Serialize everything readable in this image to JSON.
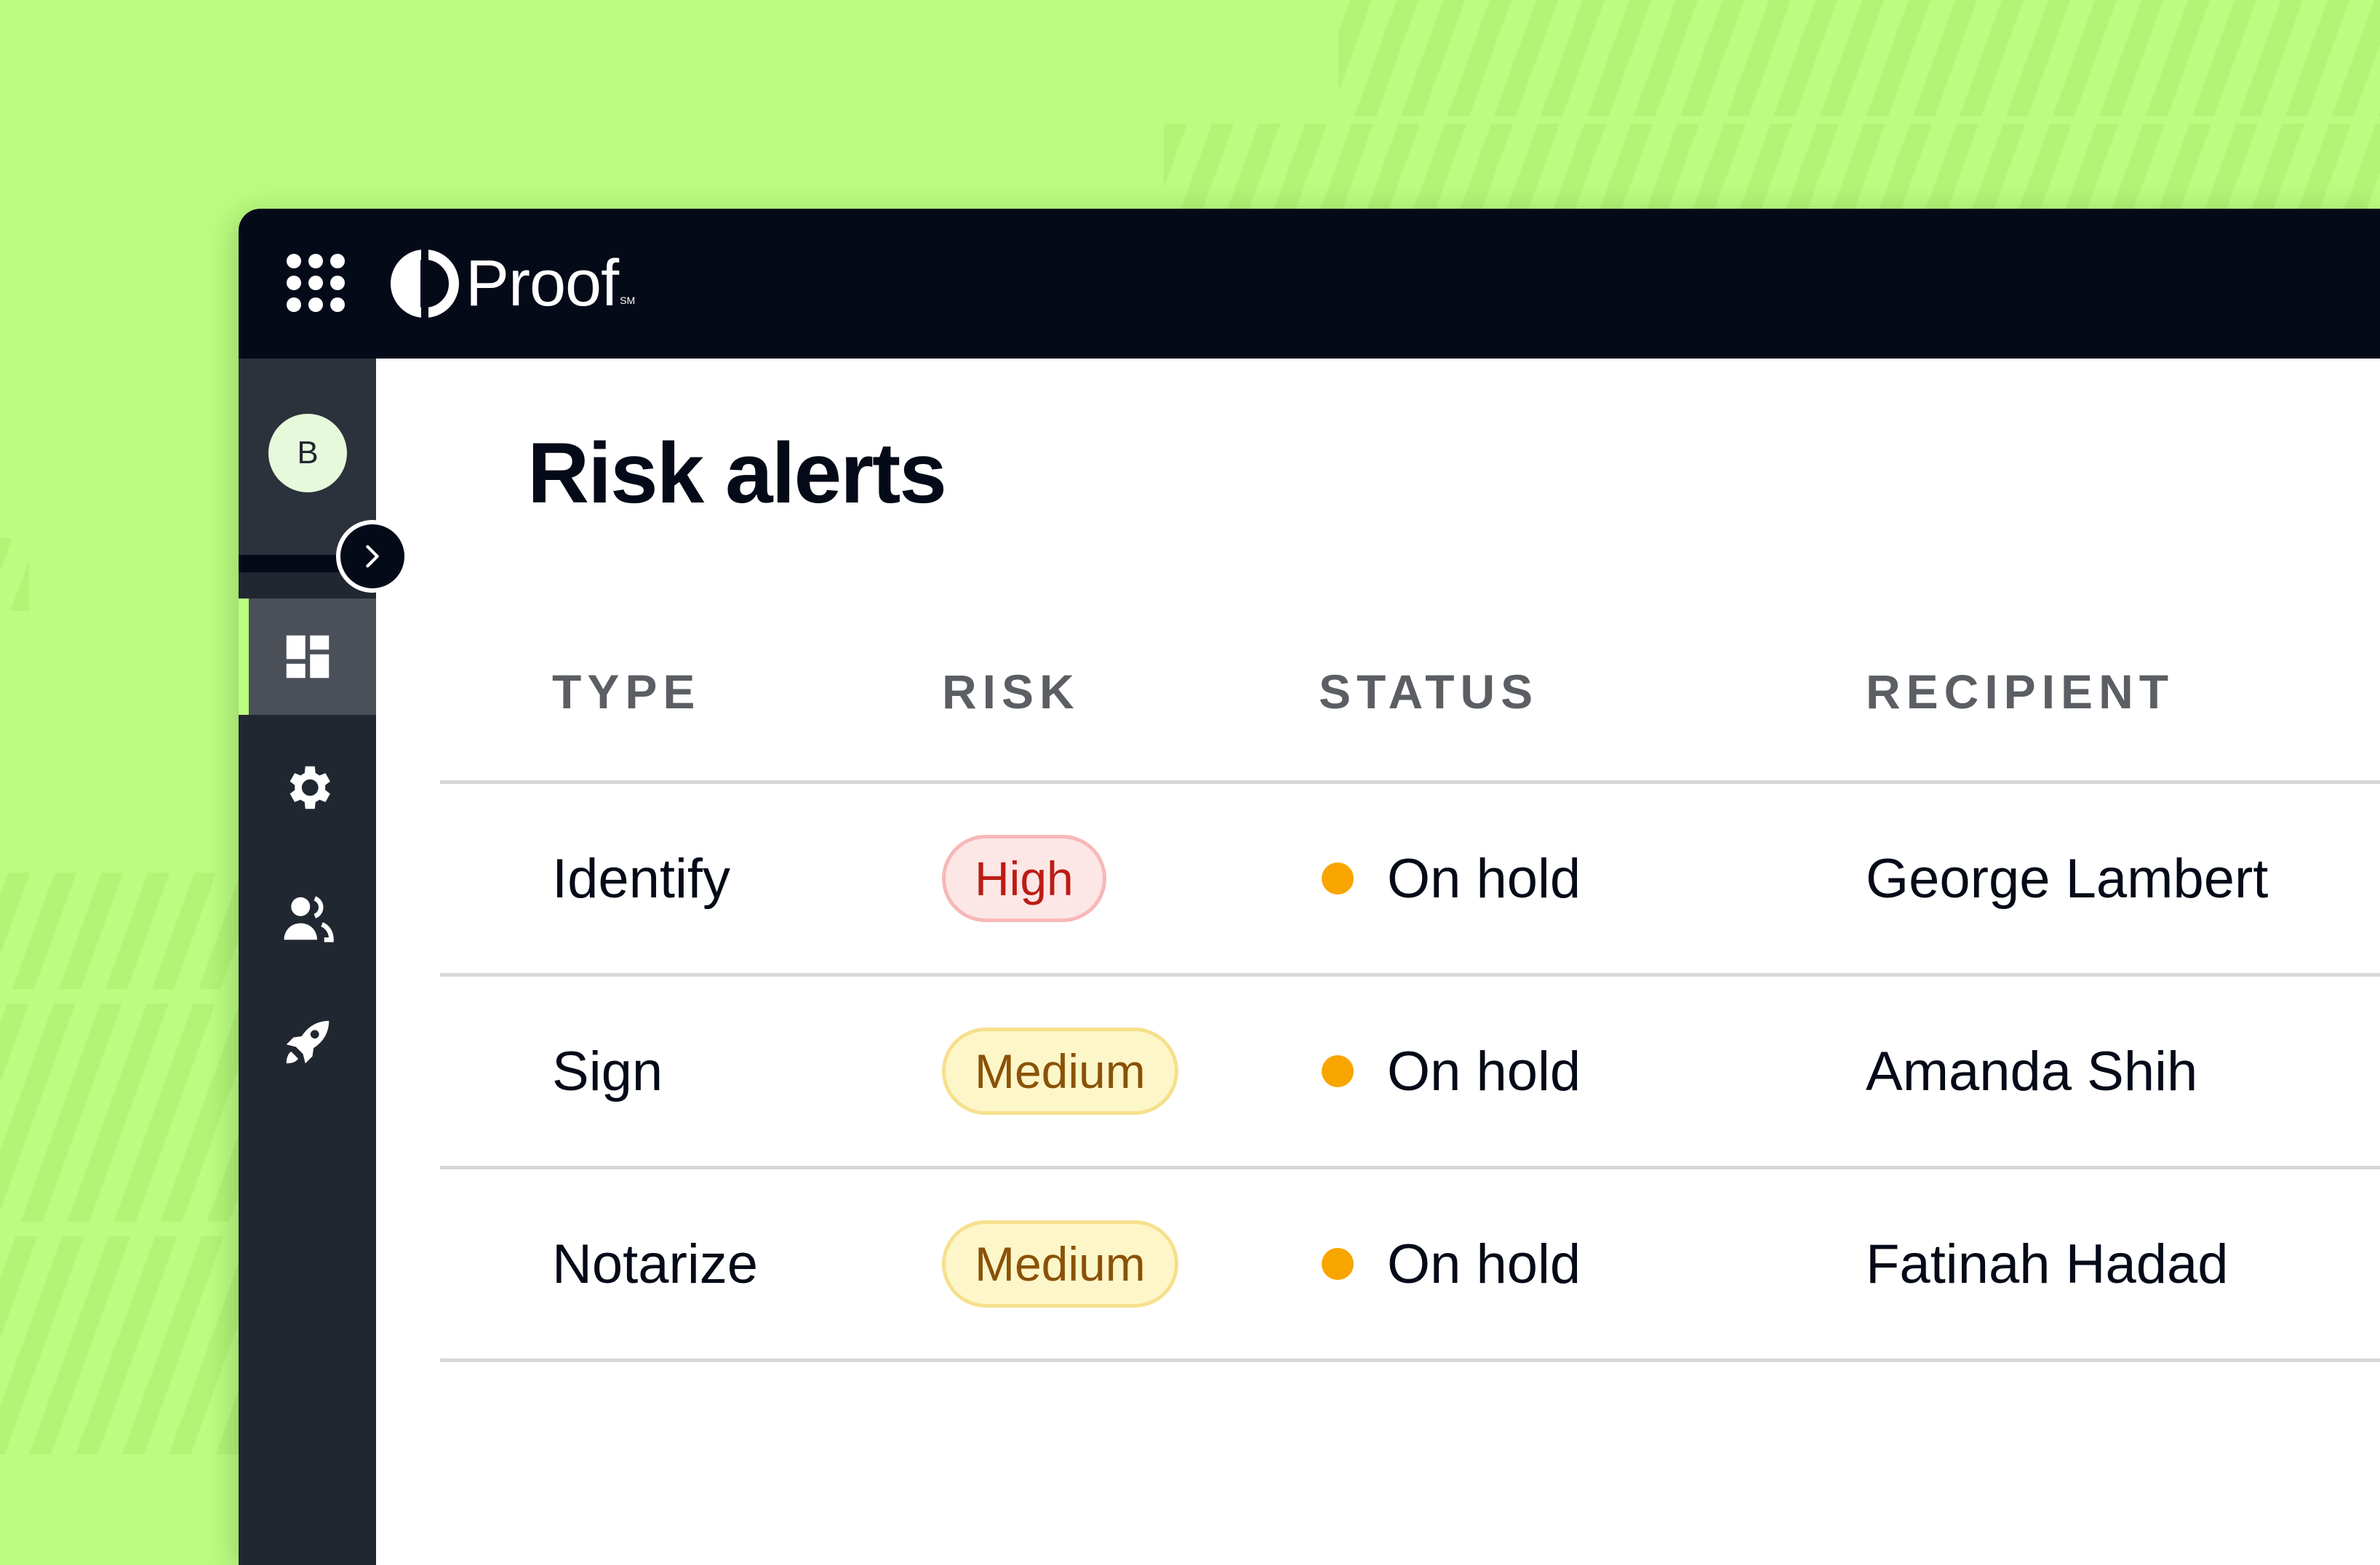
{
  "app": {
    "brand_name": "Proof",
    "brand_mark": "SM",
    "icons": {
      "apps": "grid-dots-icon",
      "logo": "proof-logo-icon",
      "collapse": "chevron-right-icon"
    }
  },
  "sidebar": {
    "avatar_initial": "B",
    "items": [
      {
        "name": "dashboard",
        "icon": "dashboard-icon",
        "active": true
      },
      {
        "name": "settings",
        "icon": "gear-icon",
        "active": false
      },
      {
        "name": "team",
        "icon": "users-icon",
        "active": false
      },
      {
        "name": "launch",
        "icon": "rocket-icon",
        "active": false
      }
    ]
  },
  "main": {
    "title": "Risk alerts",
    "columns": [
      "TYPE",
      "RISK",
      "STATUS",
      "RECIPIENT"
    ],
    "rows": [
      {
        "type": "Identify",
        "risk": "High",
        "risk_level": "high",
        "status": "On hold",
        "recipient": "George Lambert"
      },
      {
        "type": "Sign",
        "risk": "Medium",
        "risk_level": "medium",
        "status": "On hold",
        "recipient": "Amanda Shih"
      },
      {
        "type": "Notarize",
        "risk": "Medium",
        "risk_level": "medium",
        "status": "On hold",
        "recipient": "Fatinah Hadad"
      }
    ]
  },
  "colors": {
    "background": "#bafd80",
    "topbar": "#050a18",
    "sidebar": "#212730",
    "accent": "#bafd80",
    "status_on_hold": "#f9a500",
    "risk_high_text": "#bb1d15",
    "risk_medium_text": "#8a5207"
  }
}
